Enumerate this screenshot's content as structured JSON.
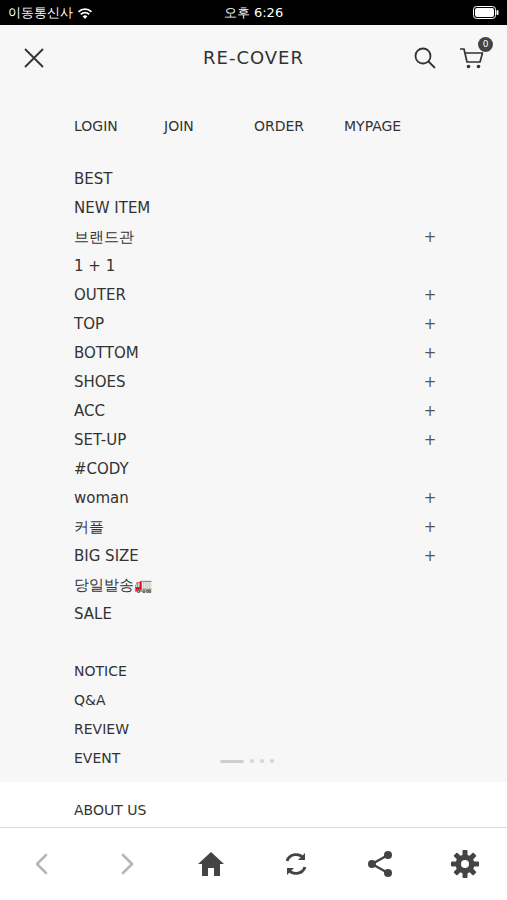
{
  "status_bar": {
    "carrier": "이동통신사",
    "time": "오후 6:26"
  },
  "header": {
    "title": "RE-COVER",
    "cart_count": "0"
  },
  "account_links": [
    "LOGIN",
    "JOIN",
    "ORDER",
    "MYPAGE"
  ],
  "menu": {
    "expand_symbol": "+",
    "items": [
      {
        "label": "BEST",
        "expandable": false
      },
      {
        "label": "NEW ITEM",
        "expandable": false
      },
      {
        "label": "브랜드관",
        "expandable": true
      },
      {
        "label": "1 + 1",
        "expandable": false
      },
      {
        "label": "OUTER",
        "expandable": true
      },
      {
        "label": "TOP",
        "expandable": true
      },
      {
        "label": "BOTTOM",
        "expandable": true
      },
      {
        "label": "SHOES",
        "expandable": true
      },
      {
        "label": "ACC",
        "expandable": true
      },
      {
        "label": "SET-UP",
        "expandable": true
      },
      {
        "label": "#CODY",
        "expandable": false
      },
      {
        "label": "woman",
        "expandable": true
      },
      {
        "label": "커플",
        "expandable": true
      },
      {
        "label": "BIG SIZE",
        "expandable": true
      },
      {
        "label": "당일발송🚛",
        "expandable": false
      },
      {
        "label": "SALE",
        "expandable": false
      }
    ]
  },
  "board_links": [
    "NOTICE",
    "Q&A",
    "REVIEW",
    "EVENT"
  ],
  "carousel": [
    {
      "selected": true
    },
    {
      "selected": false
    },
    {
      "selected": false
    },
    {
      "selected": false
    }
  ],
  "about": "ABOUT US",
  "toolbar": [
    {
      "kind": "back",
      "disabled": true
    },
    {
      "kind": "forward",
      "disabled": true
    },
    {
      "kind": "home",
      "disabled": false
    },
    {
      "kind": "refresh",
      "disabled": false
    },
    {
      "kind": "share",
      "disabled": false
    },
    {
      "kind": "settings",
      "disabled": false
    }
  ]
}
